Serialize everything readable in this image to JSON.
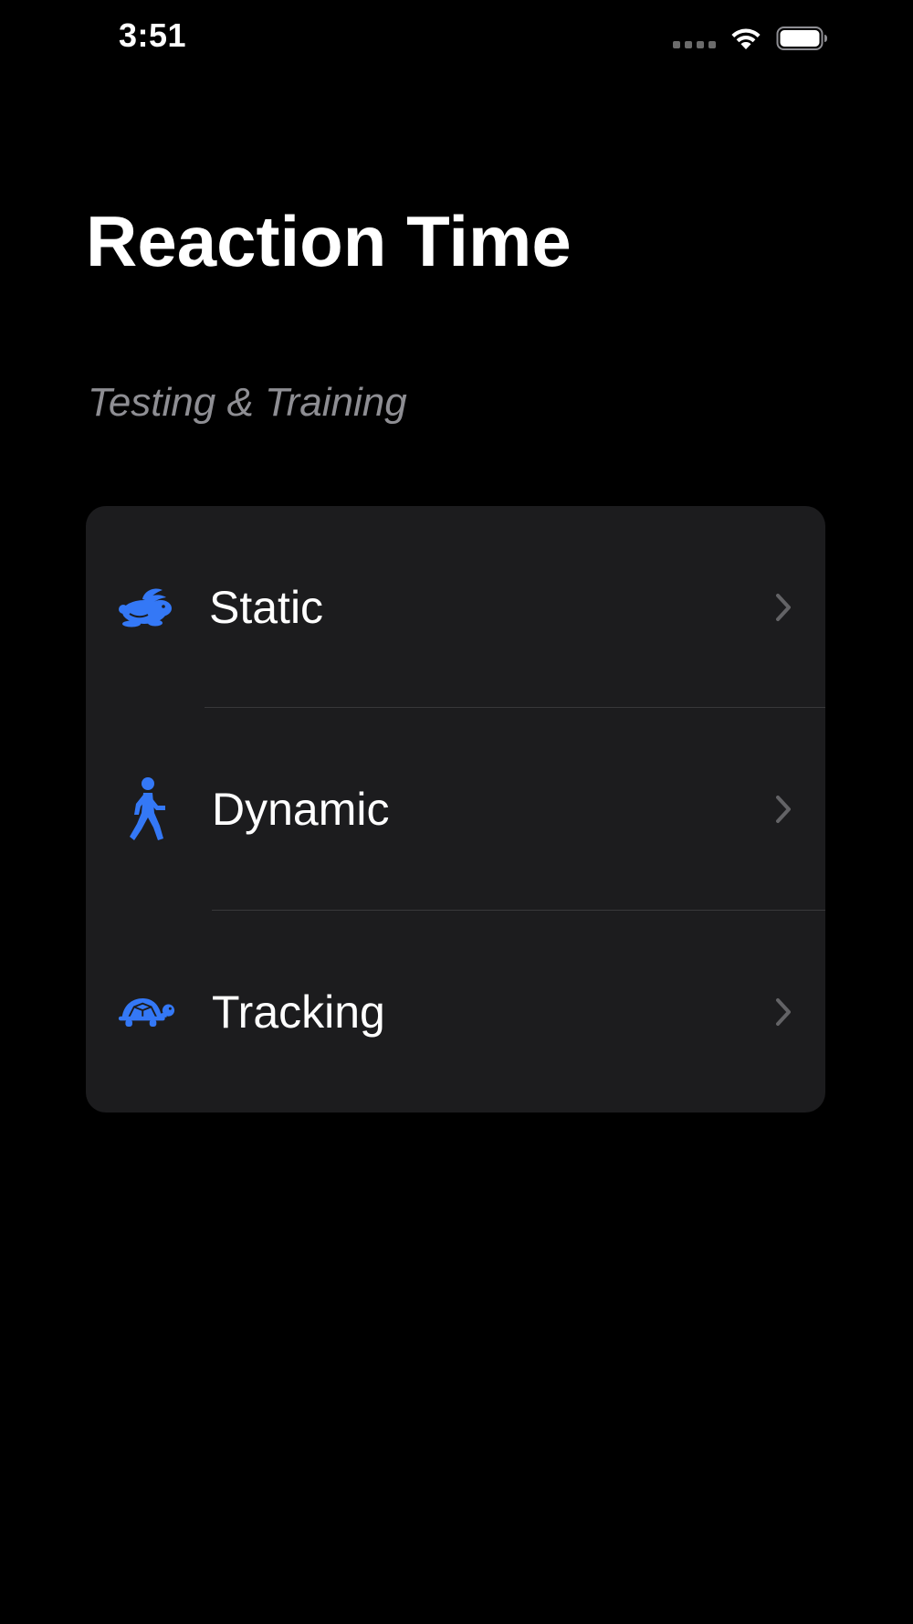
{
  "status_bar": {
    "time": "3:51",
    "icons": [
      "cellular-signal-icon",
      "wifi-icon",
      "battery-icon"
    ]
  },
  "header": {
    "title": "Reaction Time",
    "subtitle": "Testing & Training"
  },
  "menu": {
    "items": [
      {
        "label": "Static",
        "icon": "rabbit-icon"
      },
      {
        "label": "Dynamic",
        "icon": "walking-figure-icon"
      },
      {
        "label": "Tracking",
        "icon": "tortoise-icon"
      }
    ]
  },
  "colors": {
    "background": "#000000",
    "card": "#1c1c1e",
    "accent": "#3478f6",
    "subtitle": "#8e8e93",
    "chevron": "#636366",
    "separator": "#38383a"
  }
}
